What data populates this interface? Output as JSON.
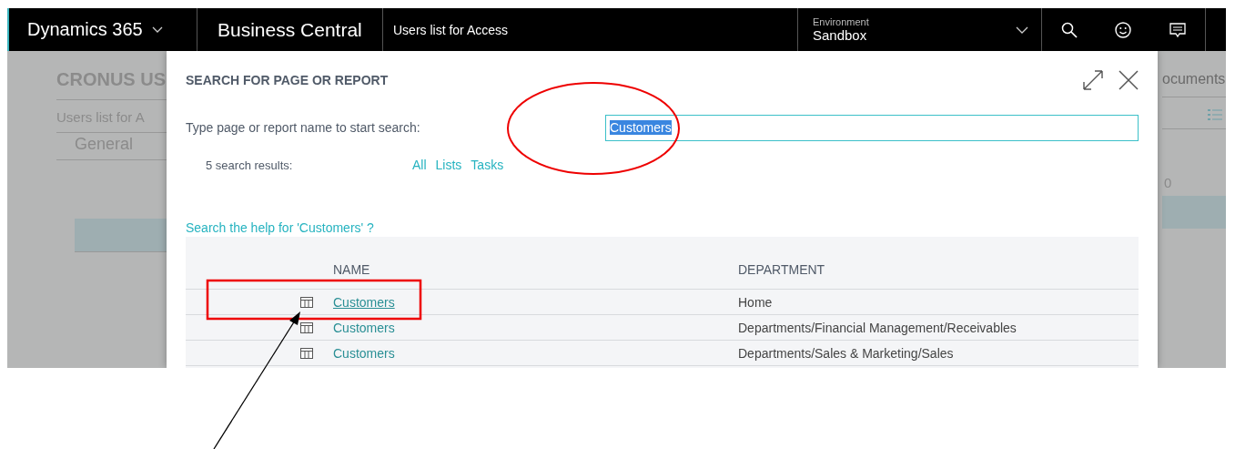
{
  "top_bar": {
    "product": "Dynamics 365",
    "app": "Business Central",
    "page_title": "Users list for Access",
    "environment": {
      "label": "Environment",
      "value": "Sandbox"
    }
  },
  "background_page": {
    "company": "CRONUS US",
    "page": "Users list for A",
    "section": "General",
    "right_text": "ocuments",
    "right_number": "0"
  },
  "dialog": {
    "title": "SEARCH FOR PAGE OR REPORT",
    "search_label": "Type page or report name to start search:",
    "search_value": "Customers",
    "value_selected": true,
    "results_count": "5 search results:",
    "filters": [
      {
        "label": "All"
      },
      {
        "label": "Lists"
      },
      {
        "label": "Tasks"
      }
    ],
    "help_link": "Search the help for 'Customers' ?",
    "table": {
      "columns": [
        "NAME",
        "DEPARTMENT"
      ],
      "rows": [
        {
          "name": "Customers",
          "department": "Home",
          "selected": true
        },
        {
          "name": "Customers",
          "department": "Departments/Financial Management/Receivables",
          "selected": false
        },
        {
          "name": "Customers",
          "department": "Departments/Sales & Marketing/Sales",
          "selected": false
        }
      ]
    }
  }
}
